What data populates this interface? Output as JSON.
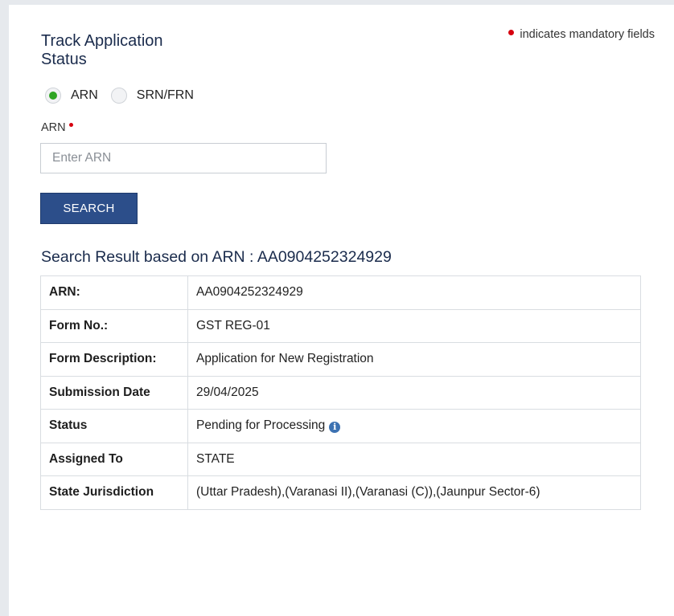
{
  "page": {
    "title": "Track Application Status",
    "mandatory_note": "indicates mandatory fields"
  },
  "colors": {
    "accent_blue": "#2c4e8a",
    "title_navy": "#1a2b4c",
    "mandatory_red": "#d6000f",
    "radio_green": "#2fa523"
  },
  "search_type": {
    "options": [
      {
        "label": "ARN",
        "selected": true
      },
      {
        "label": "SRN/FRN",
        "selected": false
      }
    ]
  },
  "form": {
    "field_label": "ARN",
    "input_placeholder": "Enter ARN",
    "input_value": "",
    "search_label": "SEARCH"
  },
  "result": {
    "heading": "Search Result based on ARN : AA0904252324929",
    "rows": [
      {
        "key": "ARN:",
        "value": "AA0904252324929"
      },
      {
        "key": "Form No.:",
        "value": "GST REG-01"
      },
      {
        "key": "Form Description:",
        "value": "Application for New Registration"
      },
      {
        "key": "Submission Date",
        "value": "29/04/2025"
      },
      {
        "key": "Status",
        "value": "Pending for Processing",
        "icon": "info-icon"
      },
      {
        "key": "Assigned To",
        "value": "STATE"
      },
      {
        "key": "State Jurisdiction",
        "value": "(Uttar Pradesh),(Varanasi II),(Varanasi (C)),(Jaunpur Sector-6)"
      }
    ]
  }
}
